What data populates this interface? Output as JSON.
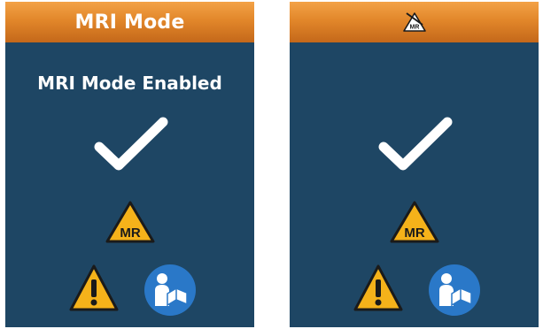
{
  "screens": {
    "left": {
      "header_title": "MRI Mode",
      "status_text": "MRI Mode Enabled"
    },
    "right": {
      "header_title": "",
      "header_icon": "mr-unsafe-icon"
    }
  },
  "mr_sign_label": "MR",
  "icons": {
    "confirm": "checkmark-icon",
    "mr": "mr-conditional-icon",
    "warning": "warning-icon",
    "manual": "consult-manual-icon"
  },
  "colors": {
    "screen_background": "#1e4664",
    "header_orange": "#e2872a",
    "sign_yellow": "#f5b21a",
    "manual_blue": "#2a78c8",
    "text": "#ffffff"
  }
}
